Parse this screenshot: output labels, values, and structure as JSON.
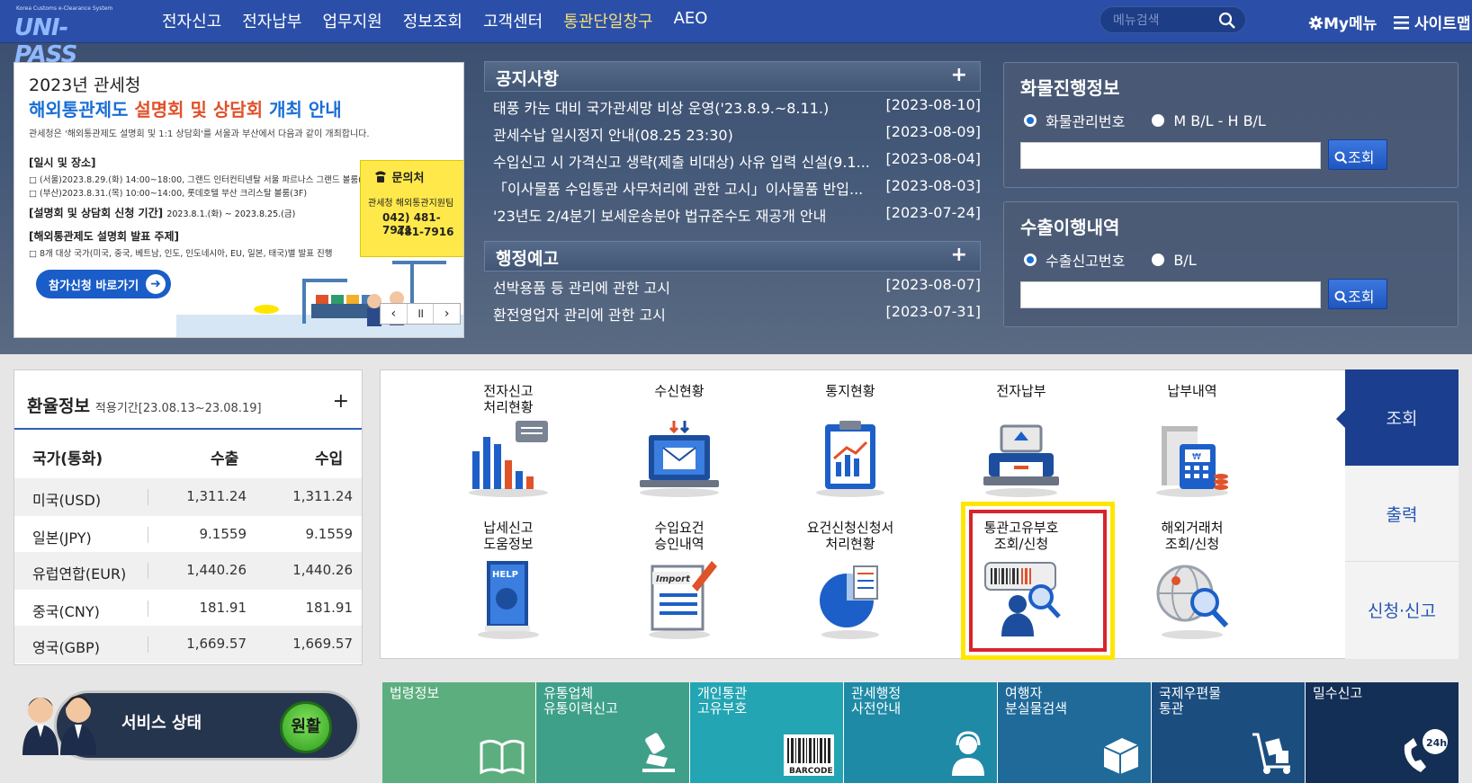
{
  "header": {
    "logo_sub": "Korea Customs e-Clearance System",
    "logo": "UNI-PASS",
    "menu": [
      "전자신고",
      "전자납부",
      "업무지원",
      "정보조회",
      "고객센터",
      "통관단일창구",
      "AEO"
    ],
    "search_placeholder": "메뉴검색",
    "mymenu": "My메뉴",
    "sitemap": "사이트맵"
  },
  "banner": {
    "title_line1": "2023년 관세청",
    "title_line2a": "해외통관제도 ",
    "title_line2b": "설명회 및 상담회",
    "title_line2c": " 개최 안내",
    "desc": "관세청은 '해외통관제도 설명회 및 1:1 상담회'를 서울과 부산에서 다음과 같이 개최합니다.",
    "h1": "[일시 및 장소]",
    "l1": "□ (서울)2023.8.29.(화) 14:00~18:00, 그랜드 인터컨티넨탈 서울 파르나스 그랜드 볼룸(5F)",
    "l2": "□ (부산)2023.8.31.(목) 10:00~14:00, 롯데호텔 부산 크리스탈 볼룸(3F)",
    "h2": "[설명회 및 상담회 신청 기간]",
    "h2sub": "2023.8.1.(화) ~ 2023.8.25.(금)",
    "h3": "[해외통관제도 설명회 발표 주제]",
    "l3": "□ 8개 대상 국가(미국, 중국, 베트남, 인도, 인도네시아, EU, 일본, 태국)별 발표 진행",
    "contact_title": "문의처",
    "contact_org": "관세청 해외통관지원팀",
    "contact_tel1": "042) 481-7971",
    "contact_tel2": "481-7916",
    "apply_label": "참가신청 바로가기",
    "ctl_prev": "‹",
    "ctl_pause": "॥",
    "ctl_next": "›"
  },
  "notices": {
    "title": "공지사항",
    "plus": "+",
    "items": [
      {
        "text": "태풍 카눈 대비 국가관세망 비상 운영('23.8.9.~8.11.)",
        "date": "[2023-08-10]"
      },
      {
        "text": "관세수납 일시정지 안내(08.25 23:30)",
        "date": "[2023-08-09]"
      },
      {
        "text": "수입신고 시 가격신고 생략(제출 비대상) 사유 입력 신설(9.1...",
        "date": "[2023-08-04]"
      },
      {
        "text": "「이사물품 수입통관 사무처리에 관한 고시」이사물품 반입...",
        "date": "[2023-08-03]"
      },
      {
        "text": "'23년도 2/4분기 보세운송분야 법규준수도 재공개 안내",
        "date": "[2023-07-24]"
      }
    ]
  },
  "admin_notices": {
    "title": "행정예고",
    "plus": "+",
    "items": [
      {
        "text": "선박용품 등 관리에 관한 고시",
        "date": "[2023-08-07]"
      },
      {
        "text": "환전영업자 관리에 관한 고시",
        "date": "[2023-07-31]"
      }
    ]
  },
  "cargo": {
    "title": "화물진행정보",
    "opt1": "화물관리번호",
    "opt2": "M B/L - H B/L",
    "button": "조회"
  },
  "export": {
    "title": "수출이행내역",
    "opt1": "수출신고번호",
    "opt2": "B/L",
    "button": "조회"
  },
  "fx": {
    "title": "환율정보",
    "period": "적용기간[23.08.13~23.08.19]",
    "plus": "+",
    "headers": [
      "국가(통화)",
      "수출",
      "수입"
    ],
    "rows": [
      [
        "미국(USD)",
        "1,311.24",
        "1,311.24"
      ],
      [
        "일본(JPY)",
        "9.1559",
        "9.1559"
      ],
      [
        "유럽연합(EUR)",
        "1,440.26",
        "1,440.26"
      ],
      [
        "중국(CNY)",
        "181.91",
        "181.91"
      ],
      [
        "영국(GBP)",
        "1,669.57",
        "1,669.57"
      ]
    ]
  },
  "service": {
    "label": "서비스 상태",
    "status": "원활"
  },
  "quick": [
    {
      "name": "전자신고\n처리현황"
    },
    {
      "name": "수신현황"
    },
    {
      "name": "통지현황"
    },
    {
      "name": "전자납부"
    },
    {
      "name": "납부내역"
    },
    {
      "name": "납세신고\n도움정보"
    },
    {
      "name": "수입요건\n승인내역"
    },
    {
      "name": "요건신청신청서\n처리현황"
    },
    {
      "name": "통관고유부호\n조회/신청"
    },
    {
      "name": "해외거래처\n조회/신청"
    }
  ],
  "side_tabs": [
    "조회",
    "출력",
    "신청·신고"
  ],
  "icon_text": {
    "help": "HELP",
    "import": "Import",
    "barcode": "BARCODE",
    "h24": "24h"
  },
  "tiles": [
    {
      "label": "법령정보",
      "color": "#5cae7f"
    },
    {
      "label": "유통업체\n유통이력신고",
      "color": "#3fa08a"
    },
    {
      "label": "개인통관\n고유부호",
      "color": "#23a5b3"
    },
    {
      "label": "관세행정\n사전안내",
      "color": "#1f8aa6"
    },
    {
      "label": "여행자\n분실물검색",
      "color": "#1f6a99"
    },
    {
      "label": "국제우편물\n통관",
      "color": "#1b4e7f"
    },
    {
      "label": "밀수신고",
      "color": "#142f56"
    }
  ]
}
